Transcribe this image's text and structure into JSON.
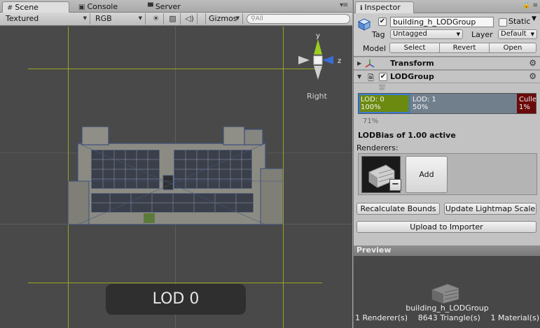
{
  "scene": {
    "tabs": [
      {
        "label": "Scene",
        "icon": "grid-icon"
      },
      {
        "label": "Console",
        "icon": "console-icon"
      },
      {
        "label": "Server",
        "icon": "server-icon"
      }
    ],
    "toolbar": {
      "render_mode": "Textured",
      "color_mode": "RGB",
      "gizmos_label": "Gizmos",
      "search_placeholder": "All"
    },
    "view_label": "Right",
    "axis_labels": {
      "y": "y",
      "z": "z"
    },
    "lod_overlay": "LOD 0"
  },
  "inspector": {
    "tab_label": "Inspector",
    "object_name": "building_h_LODGroup",
    "active": true,
    "static_label": "Static",
    "static_checked": false,
    "tag_label": "Tag",
    "tag_value": "Untagged",
    "layer_label": "Layer",
    "layer_value": "Default",
    "model_label": "Model",
    "model_buttons": [
      "Select",
      "Revert",
      "Open"
    ],
    "transform_label": "Transform",
    "lodgroup_label": "LODGroup",
    "lodgroup_enabled": true,
    "lod_levels": [
      {
        "label": "LOD: 0",
        "percent": "100%",
        "color": "#6b8a0f"
      },
      {
        "label": "LOD: 1",
        "percent": "50%",
        "color": "#717f8d"
      },
      {
        "label": "Culled",
        "percent": "1%",
        "color": "#6a0a0a"
      }
    ],
    "current_percent": "71%",
    "lodbias_text": "LODBias of 1.00 active",
    "renderers_label": "Renderers:",
    "add_label": "Add",
    "remove_label": "−",
    "recalc_label": "Recalculate Bounds",
    "lightmap_label": "Update Lightmap Scale",
    "upload_label": "Upload to Importer",
    "preview_label": "Preview",
    "preview_name": "building_h_LODGroup",
    "stats": {
      "renderers": "1 Renderer(s)",
      "triangles": "8643 Triangle(s)",
      "materials": "1 Material(s)"
    }
  },
  "colors": {
    "lod0": "#6b8a0f",
    "lod1": "#717f8d",
    "culled": "#6a0a0a",
    "guide_lines": "#9aa422",
    "selection": "#3b7bd6"
  }
}
